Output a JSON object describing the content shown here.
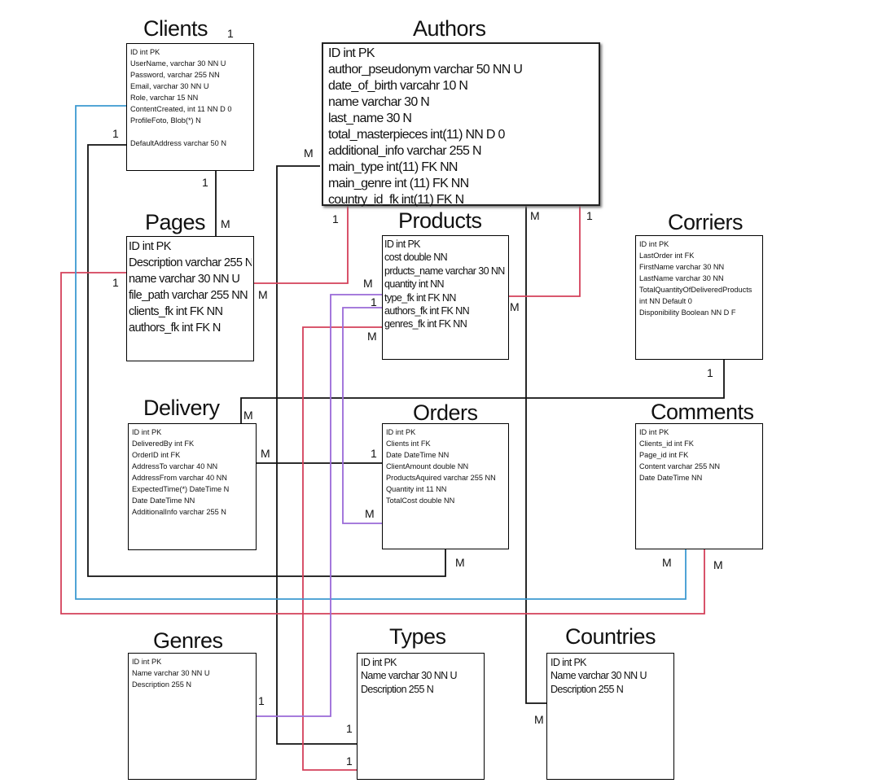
{
  "entities": {
    "clients": {
      "name": "Clients",
      "fields": [
        "ID int PK",
        "UserName,  varchar 30 NN U",
        "Password, varchar 255 NN",
        "Email, varchar 30 NN U",
        "Role, varchar 15 NN",
        "ContentCreated, int 11 NN D 0",
        "ProfileFoto, Blob(*) N",
        "",
        "DefaultAddress varchar 50 N"
      ]
    },
    "authors": {
      "name": "Authors",
      "fields": [
        "ID int PK",
        "author_pseudonym varchar 50 NN U",
        "date_of_birth varcahr 10 N",
        "name varchar 30 N",
        "last_name 30 N",
        "total_masterpieces int(11) NN D 0",
        "additional_info varchar 255 N",
        "main_type int(11) FK NN",
        "main_genre int (11) FK NN",
        "country_id_fk int(11) FK N"
      ]
    },
    "pages": {
      "name": "Pages",
      "fields": [
        "ID int PK",
        "Description varchar 255 N",
        "name varchar 30 NN U",
        "file_path varchar 255 NN",
        "clients_fk int FK NN",
        "authors_fk int FK N"
      ]
    },
    "products": {
      "name": "Products",
      "fields": [
        "ID int PK",
        "cost double NN",
        "prducts_name varchar 30 NN",
        "quantity int NN",
        "type_fk int FK NN",
        "authors_fk int FK NN",
        "genres_fk int FK NN"
      ]
    },
    "corriers": {
      "name": "Corriers",
      "fields": [
        "ID int PK",
        "LastOrder int FK",
        "FirstName varchar 30 NN",
        "LastName varchar 30 NN",
        "TotalQuantityOfDeliveredProducts",
        "int NN Default 0",
        "Disponibility Boolean NN D F"
      ]
    },
    "delivery": {
      "name": "Delivery",
      "fields": [
        "ID int PK",
        "DeliveredBy int FK",
        "OrderID int FK",
        "AddressTo varchar 40 NN",
        "AddressFrom varchar 40 NN",
        "ExpectedTime(*) DateTime N",
        "Date DateTime NN",
        "AdditionalInfo varchar 255 N"
      ]
    },
    "orders": {
      "name": "Orders",
      "fields": [
        "ID int PK",
        "Clients int FK",
        "Date DateTime NN",
        "ClientAmount double NN",
        "ProductsAquired varchar 255 NN",
        "Quantity int 11 NN",
        "TotalCost double NN"
      ]
    },
    "comments": {
      "name": "Comments",
      "fields": [
        "ID int PK",
        "Clients_id int FK",
        "Page_id int FK",
        "Content varchar 255 NN",
        "Date DateTime NN"
      ]
    },
    "genres": {
      "name": "Genres",
      "fields": [
        "ID int PK",
        "Name varchar 30 NN U",
        "Description 255 N"
      ]
    },
    "types": {
      "name": "Types",
      "fields": [
        "ID int PK",
        "Name varchar 30 NN U",
        "Description 255 N"
      ]
    },
    "countries": {
      "name": "Countries",
      "fields": [
        "ID int PK",
        "Name varchar 30 NN U",
        "Description 255 N"
      ]
    }
  },
  "cardinalities": {
    "c01": "1",
    "c02": "1",
    "c03": "M",
    "c04": "1",
    "c05": "M",
    "c06": "1",
    "c07": "M",
    "c08": "1",
    "c09": "M",
    "c10": "1",
    "c11": "M",
    "c12": "M",
    "c13": "1",
    "c14": "M",
    "c15": "M",
    "c16": "M",
    "c17": "1",
    "c18": "M",
    "c19": "M",
    "c20": "M",
    "c21": "M",
    "c22": "1",
    "c23": "1",
    "c24": "1",
    "c25": "1",
    "c26": "M"
  },
  "colors": {
    "black": "#111111",
    "red": "#d4405a",
    "blue": "#3d9ad1",
    "purple": "#9a6ad8"
  }
}
